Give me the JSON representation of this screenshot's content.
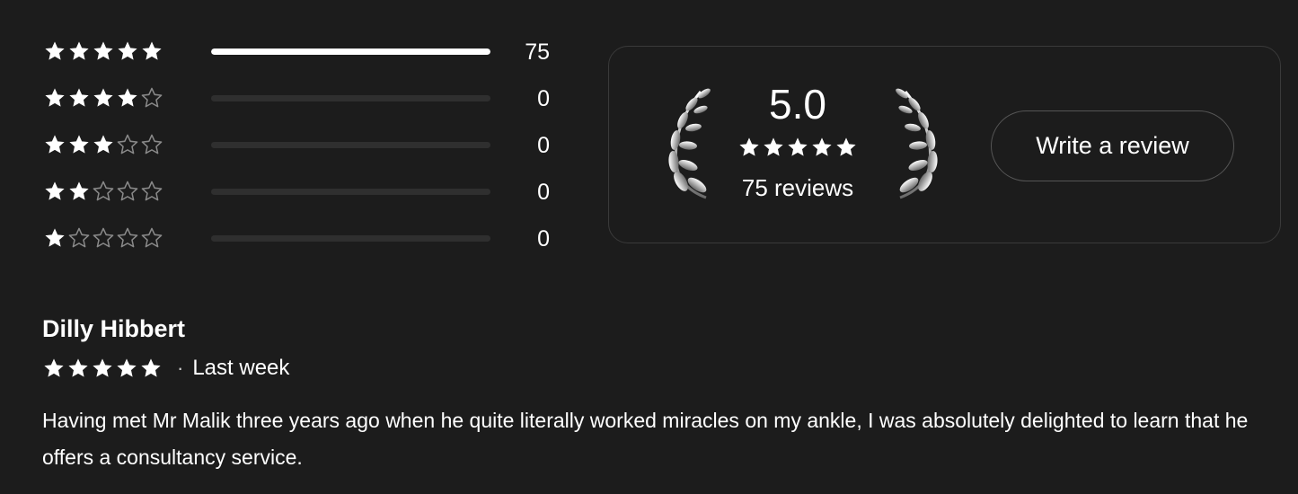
{
  "breakdown": [
    {
      "stars": 5,
      "count": "75",
      "fill": 1.0
    },
    {
      "stars": 4,
      "count": "0",
      "fill": 0
    },
    {
      "stars": 3,
      "count": "0",
      "fill": 0
    },
    {
      "stars": 2,
      "count": "0",
      "fill": 0
    },
    {
      "stars": 1,
      "count": "0",
      "fill": 0
    }
  ],
  "summary": {
    "score": "5.0",
    "stars": 5,
    "reviews_label": "75 reviews",
    "write_review_label": "Write a review"
  },
  "review": {
    "author": "Dilly Hibbert",
    "stars": 5,
    "separator": "·",
    "when": "Last week",
    "text": "Having met Mr Malik three years ago when he quite literally worked miracles on my ankle, I was absolutely delighted to learn that he offers a consultancy service."
  },
  "colors": {
    "background": "#1c1c1c",
    "text": "#ffffff",
    "star_filled": "#ffffff",
    "star_empty_outline": "#8a8a8a",
    "bar_track": "#2f2f2f",
    "bar_fill": "#ffffff"
  },
  "icons": {
    "filled_star": "star-filled-icon",
    "empty_star": "star-outline-icon",
    "laurel": "laurel-wreath-icon"
  }
}
